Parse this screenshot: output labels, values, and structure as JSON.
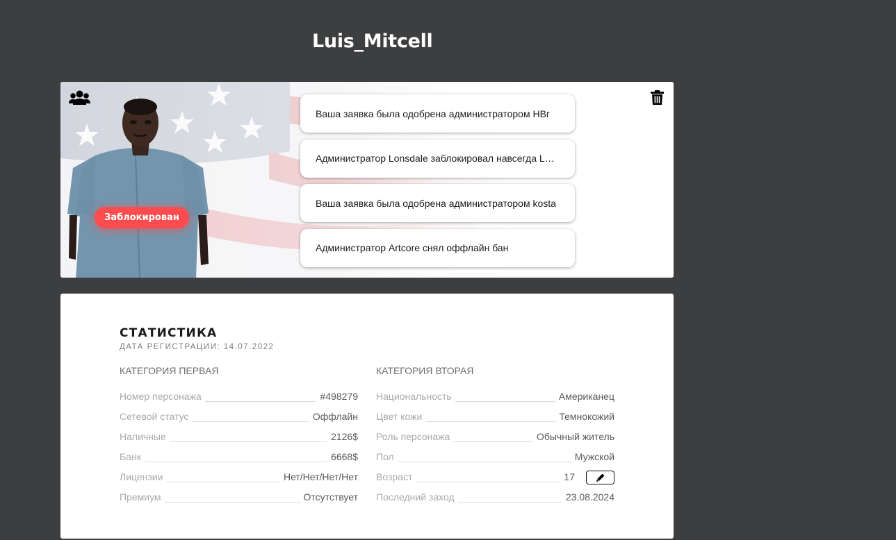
{
  "player": {
    "name": "Luis_Mitcell",
    "status_badge": "Заблокирован"
  },
  "notifications": [
    "Ваша заявка была одобрена администратором HBr",
    "Администратор Lonsdale заблокировал навсегда Luis_Mitcell",
    "Ваша заявка была одобрена администратором kosta",
    "Администратор Artcore снял оффлайн бан"
  ],
  "stats": {
    "title": "СТАТИСТИКА",
    "reg_date": "ДАТА РЕГИСТРАЦИИ: 14.07.2022",
    "category_one": {
      "title": "КАТЕГОРИЯ ПЕРВАЯ",
      "rows": [
        {
          "label": "Номер персонажа",
          "value": "#498279"
        },
        {
          "label": "Сетевой статус",
          "value": "Оффлайн"
        },
        {
          "label": "Наличные",
          "value": "2126$"
        },
        {
          "label": "Банк",
          "value": "6668$"
        },
        {
          "label": "Лицензии",
          "value": "Нет/Нет/Нет/Нет"
        },
        {
          "label": "Премиум",
          "value": "Отсутствует"
        }
      ]
    },
    "category_two": {
      "title": "КАТЕГОРИЯ ВТОРАЯ",
      "rows": [
        {
          "label": "Национальность",
          "value": "Американец"
        },
        {
          "label": "Цвет кожи",
          "value": "Темнокожий"
        },
        {
          "label": "Роль персонажа",
          "value": "Обычный житель"
        },
        {
          "label": "Пол",
          "value": "Мужской"
        },
        {
          "label": "Возраст",
          "value": "17"
        },
        {
          "label": "Последний заход",
          "value": "23.08.2024"
        }
      ]
    }
  },
  "icons": {
    "group": "users-group-icon",
    "delete": "trash-icon",
    "edit": "pencil-icon"
  },
  "colors": {
    "background": "#3d3e40",
    "badge": "#fb4d4f",
    "card": "#ffffff"
  }
}
